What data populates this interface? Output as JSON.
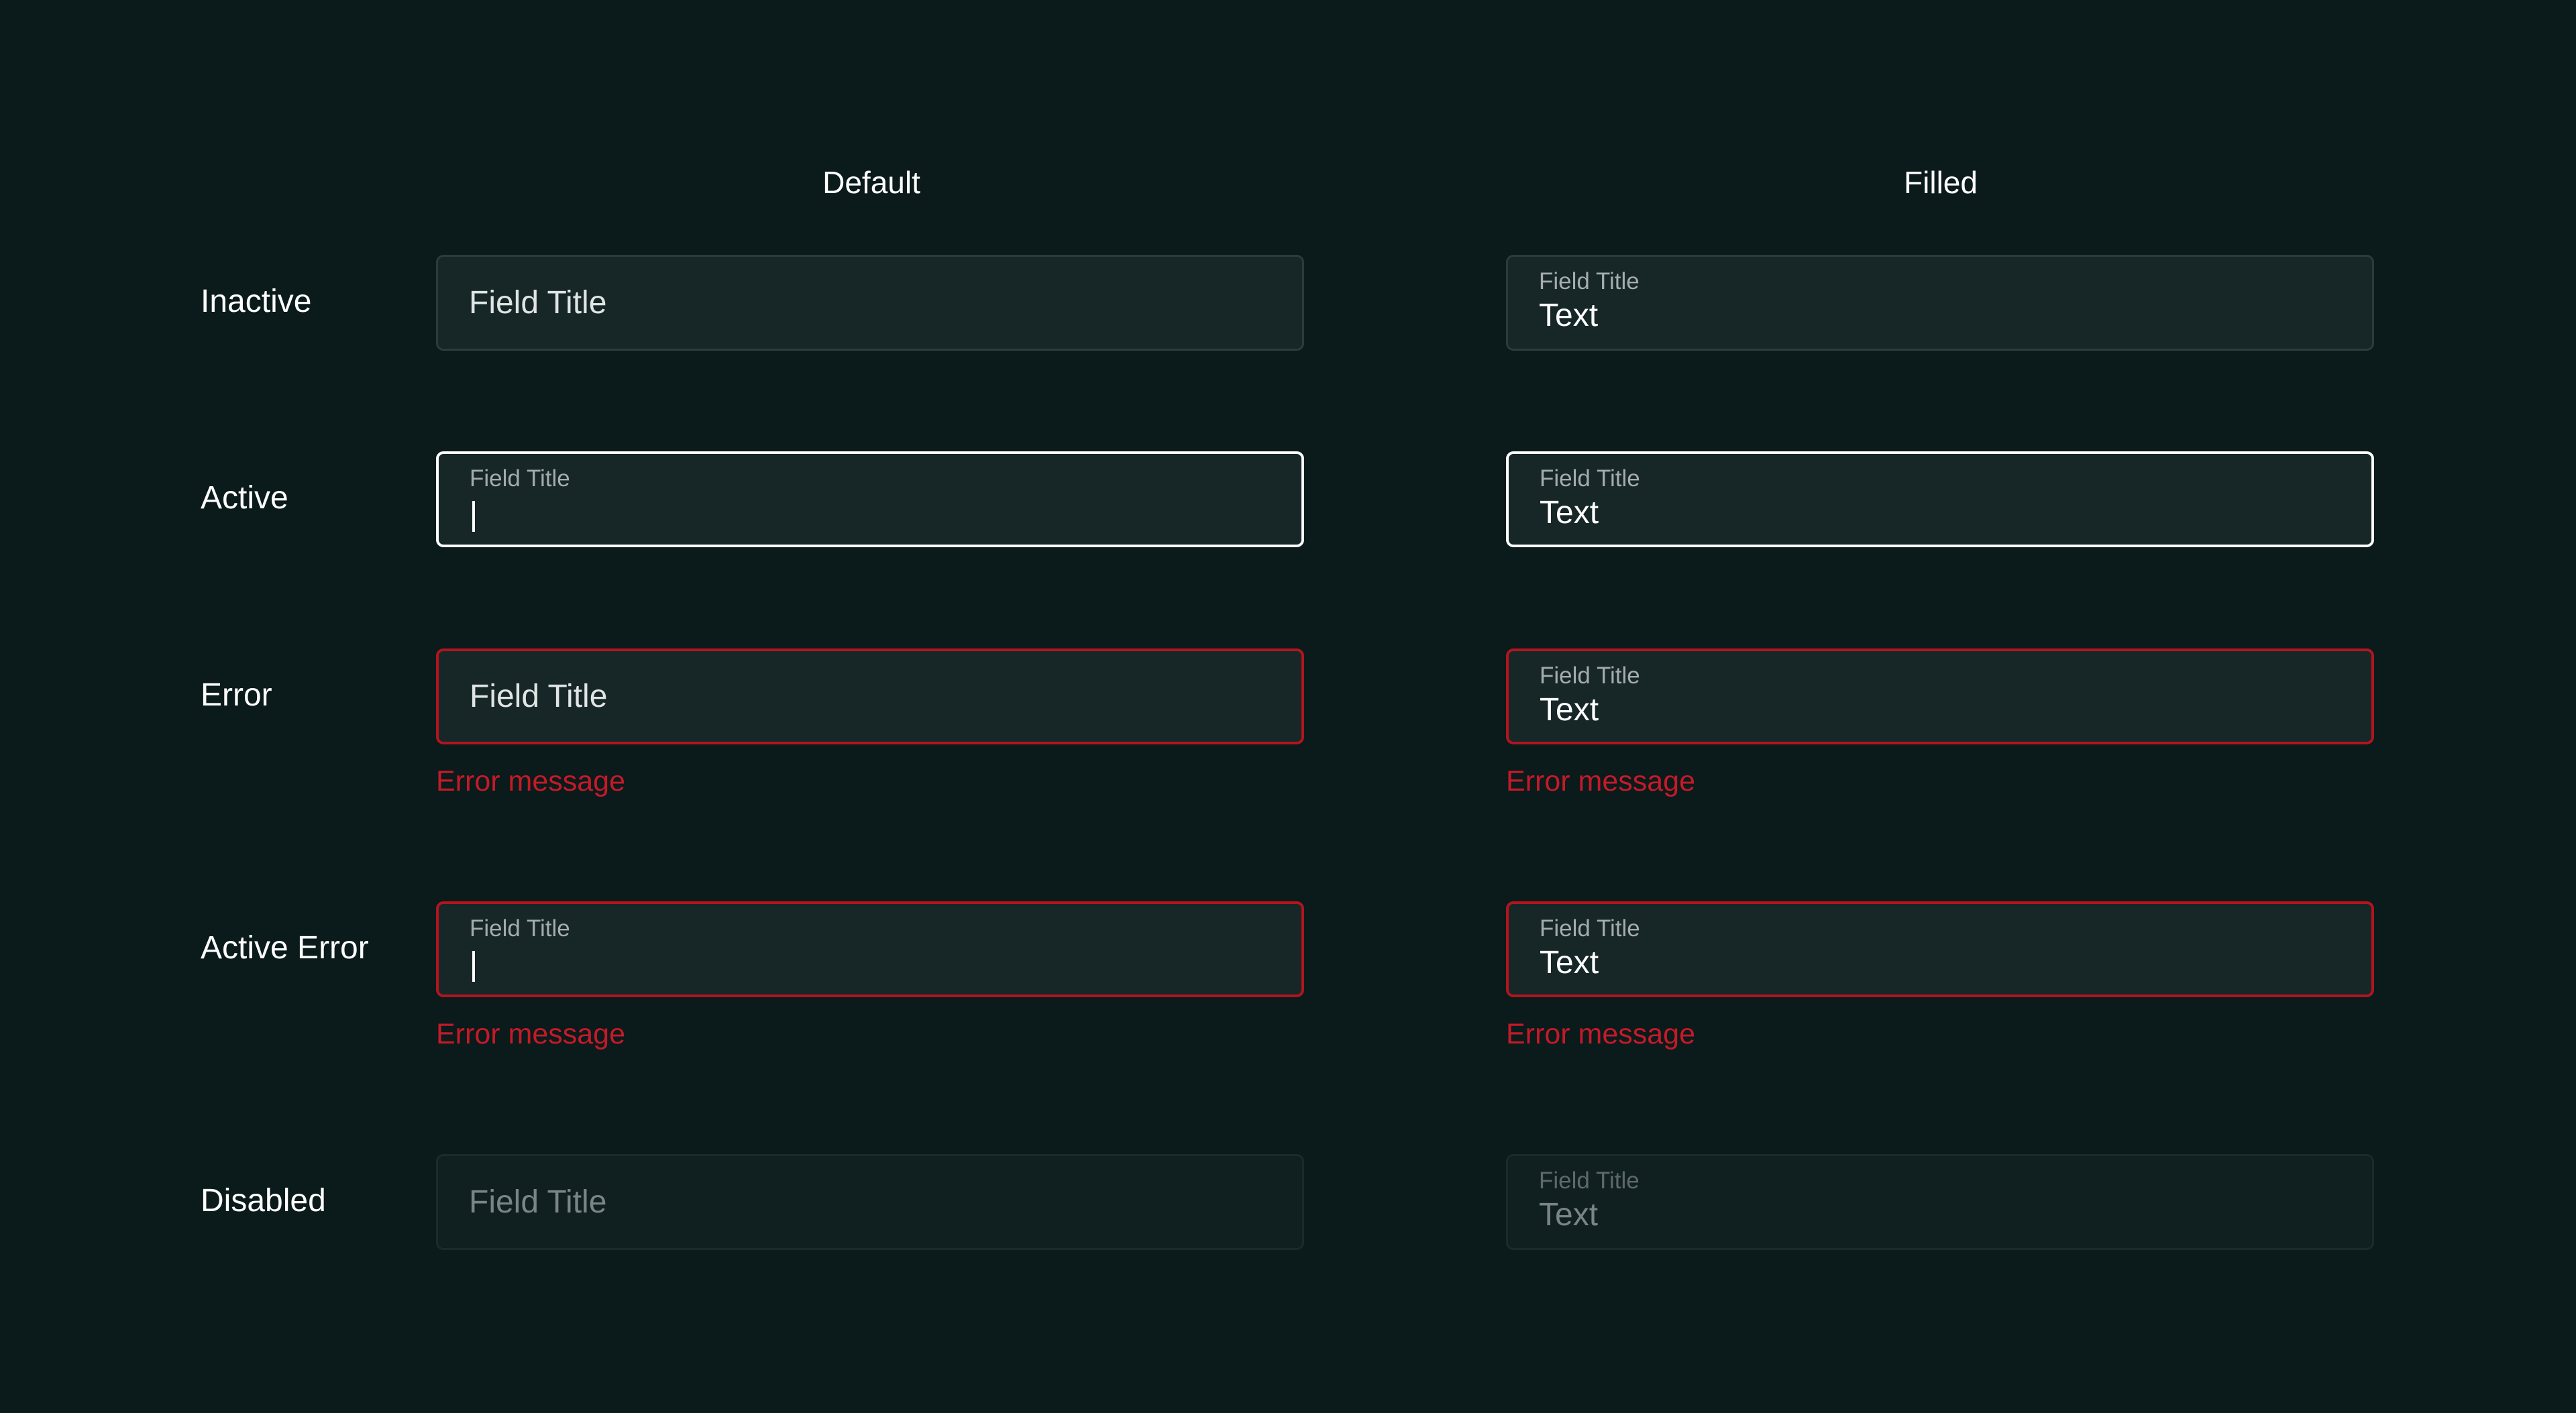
{
  "columns": {
    "default": "Default",
    "filled": "Filled"
  },
  "rows": {
    "inactive": "Inactive",
    "active": "Active",
    "error": "Error",
    "active_error": "Active Error",
    "disabled": "Disabled"
  },
  "field": {
    "title": "Field Title",
    "value": "Text",
    "error_message": "Error message"
  },
  "colors": {
    "background": "#0b1a1b",
    "field_background": "#172728",
    "active_border": "#ffffff",
    "error": "#c41a28"
  }
}
